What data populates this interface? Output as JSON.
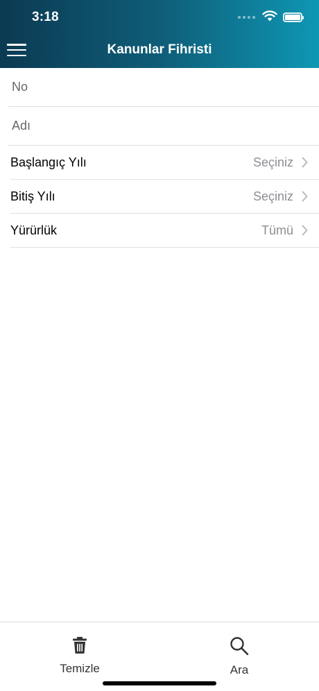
{
  "status_bar": {
    "time": "3:18"
  },
  "header": {
    "title": "Kanunlar Fihristi",
    "menu_icon": "hamburger-menu-icon"
  },
  "form": {
    "no_field": {
      "placeholder": "No",
      "value": ""
    },
    "name_field": {
      "placeholder": "Adı",
      "value": ""
    },
    "rows": [
      {
        "label": "Başlangıç Yılı",
        "value": "Seçiniz"
      },
      {
        "label": "Bitiş Yılı",
        "value": "Seçiniz"
      },
      {
        "label": "Yürürlük",
        "value": "Tümü"
      }
    ]
  },
  "tabbar": {
    "clear": {
      "label": "Temizle",
      "icon": "trash-icon"
    },
    "search": {
      "label": "Ara",
      "icon": "search-icon"
    }
  },
  "colors": {
    "header_start": "#0b3a52",
    "header_end": "#0e97b4",
    "value_gray": "#8e8e93"
  }
}
